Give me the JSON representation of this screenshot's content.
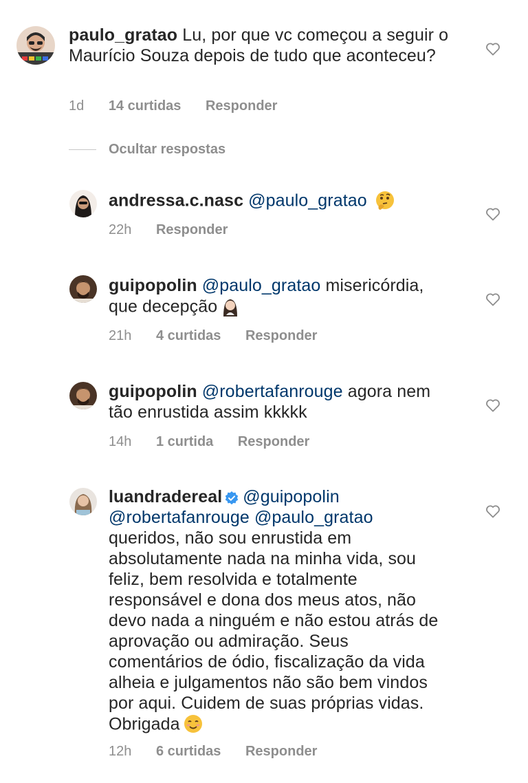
{
  "comments": [
    {
      "username": "paulo_gratao",
      "text": "Lu, por que vc começou a seguir o Maurício Souza depois de tudo que aconteceu?",
      "time": "1d",
      "likes": "14 curtidas",
      "reply": "Responder"
    }
  ],
  "hide_replies": "Ocultar respostas",
  "replies": [
    {
      "username": "andressa.c.nasc",
      "mention": "@paulo_gratao",
      "emoji": "thinking-face-emoji",
      "time": "22h",
      "reply": "Responder"
    },
    {
      "username": "guipopolin",
      "mention": "@paulo_gratao",
      "text_line1": " misericórdia,",
      "text_line2": "que decepção",
      "emoji": "woman-facepalming-emoji",
      "time": "21h",
      "likes": "4 curtidas",
      "reply": "Responder"
    },
    {
      "username": "guipopolin",
      "mention": "@robertafanrouge",
      "text_line1": " agora nem",
      "text_line2": "tão enrustida assim kkkkk",
      "time": "14h",
      "likes": "1 curtida",
      "reply": "Responder"
    },
    {
      "username": "luandradereal",
      "verified": true,
      "mention1": "@guipopolin",
      "mention2": "@robertafanrouge",
      "mention3": "@paulo_gratao",
      "lines": [
        "queridos, não sou enrustida em",
        "absolutamente nada na minha vida, sou",
        "feliz, bem resolvida e totalmente",
        "responsável e dona dos meus atos, não",
        "devo nada a ninguém e não estou atrás de",
        "aprovação ou admiração. Seus",
        "comentários de ódio, fiscalização  da vida",
        "alheia e julgamentos não são bem vindos",
        "por aqui. Cuidem de suas próprias vidas.",
        "Obrigada"
      ],
      "emoji": "smiling-face-emoji",
      "time": "12h",
      "likes": "6 curtidas",
      "reply": "Responder"
    }
  ],
  "colors": {
    "text": "#262626",
    "mention": "#00376b",
    "meta": "#8e8e8e",
    "verified": "#3897f0"
  }
}
